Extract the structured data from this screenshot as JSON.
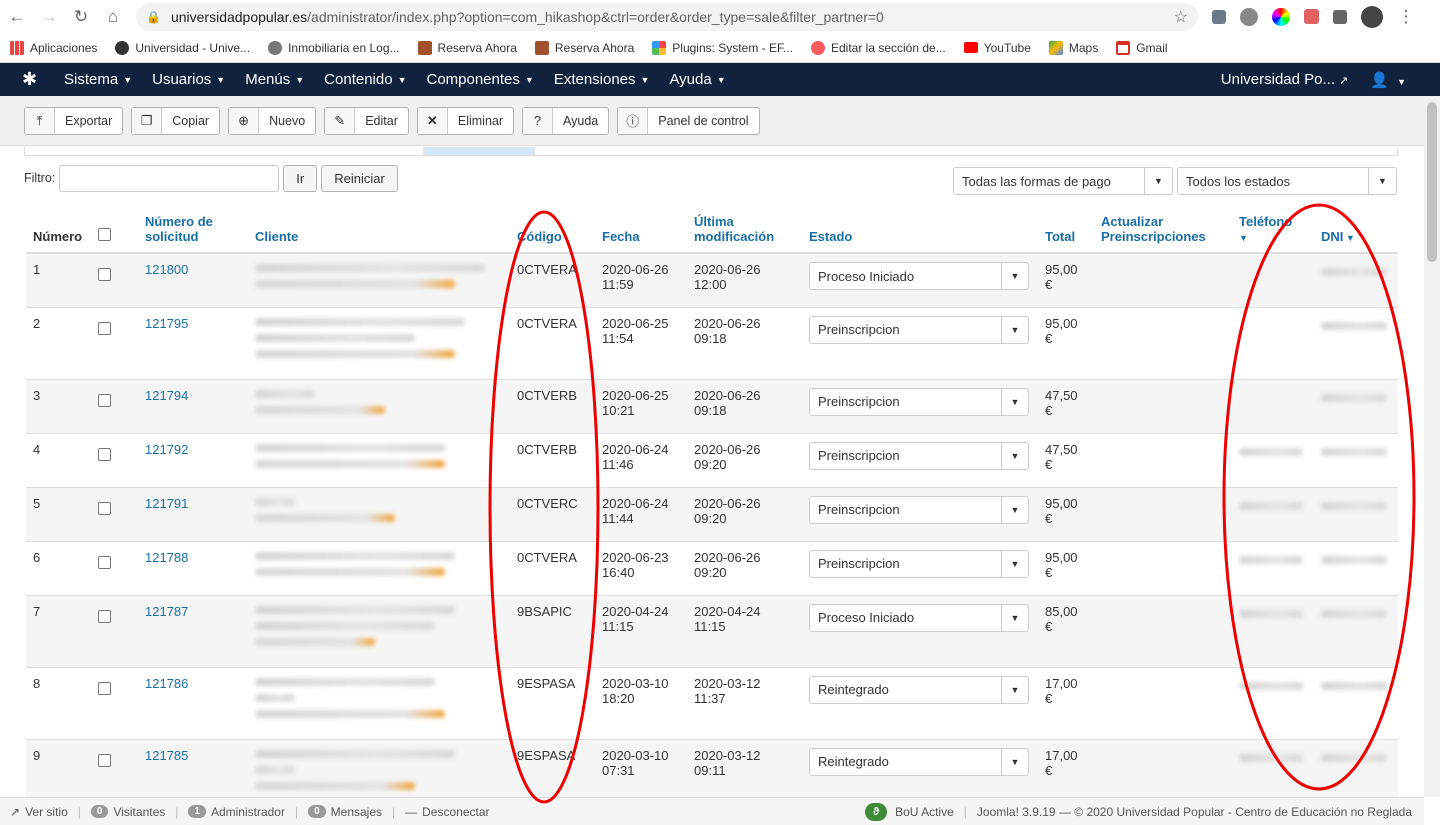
{
  "browser": {
    "url_host": "universidadpopular.es",
    "url_path": "/administrator/index.php?option=com_hikashop&ctrl=order&order_type=sale&filter_partner=0",
    "bookmarks": [
      "Aplicaciones",
      "Universidad - Unive...",
      "Inmobiliaria en Log...",
      "Reserva Ahora",
      "Reserva Ahora",
      "Plugins: System - EF...",
      "Editar la sección de...",
      "YouTube",
      "Maps",
      "Gmail"
    ]
  },
  "header": {
    "menu": [
      "Sistema",
      "Usuarios",
      "Menús",
      "Contenido",
      "Componentes",
      "Extensiones",
      "Ayuda"
    ],
    "site_name": "Universidad Po..."
  },
  "toolbar": {
    "buttons": [
      "Exportar",
      "Copiar",
      "Nuevo",
      "Editar",
      "Eliminar",
      "Ayuda",
      "Panel de control"
    ]
  },
  "filter": {
    "label": "Filtro:",
    "go": "Ir",
    "reset": "Reiniciar",
    "payment": "Todas las formas de pago",
    "status": "Todos los estados"
  },
  "table": {
    "headers": {
      "numero": "Número",
      "solicitud": "Número de solicitud",
      "cliente": "Cliente",
      "codigo": "Código",
      "fecha": "Fecha",
      "modificacion": "Última modificación",
      "estado": "Estado",
      "total": "Total",
      "actualizar": "Actualizar Preinscripciones",
      "telefono": "Teléfono",
      "dni": "DNI"
    },
    "rows": [
      {
        "n": "1",
        "id": "121800",
        "code": "0CTVERA",
        "date": "2020-06-26",
        "time": "11:59",
        "mdate": "2020-06-26",
        "mtime": "12:00",
        "estado": "Proceso Iniciado",
        "total": "95,00",
        "cur": "€"
      },
      {
        "n": "2",
        "id": "121795",
        "code": "0CTVERA",
        "date": "2020-06-25",
        "time": "11:54",
        "mdate": "2020-06-26",
        "mtime": "09:18",
        "estado": "Preinscripcion",
        "total": "95,00",
        "cur": "€"
      },
      {
        "n": "3",
        "id": "121794",
        "code": "0CTVERB",
        "date": "2020-06-25",
        "time": "10:21",
        "mdate": "2020-06-26",
        "mtime": "09:18",
        "estado": "Preinscripcion",
        "total": "47,50",
        "cur": "€"
      },
      {
        "n": "4",
        "id": "121792",
        "code": "0CTVERB",
        "date": "2020-06-24",
        "time": "11:46",
        "mdate": "2020-06-26",
        "mtime": "09:20",
        "estado": "Preinscripcion",
        "total": "47,50",
        "cur": "€"
      },
      {
        "n": "5",
        "id": "121791",
        "code": "0CTVERC",
        "date": "2020-06-24",
        "time": "11:44",
        "mdate": "2020-06-26",
        "mtime": "09:20",
        "estado": "Preinscripcion",
        "total": "95,00",
        "cur": "€"
      },
      {
        "n": "6",
        "id": "121788",
        "code": "0CTVERA",
        "date": "2020-06-23",
        "time": "16:40",
        "mdate": "2020-06-26",
        "mtime": "09:20",
        "estado": "Preinscripcion",
        "total": "95,00",
        "cur": "€"
      },
      {
        "n": "7",
        "id": "121787",
        "code": "9BSAPIC",
        "date": "2020-04-24",
        "time": "11:15",
        "mdate": "2020-04-24",
        "mtime": "11:15",
        "estado": "Proceso Iniciado",
        "total": "85,00",
        "cur": "€"
      },
      {
        "n": "8",
        "id": "121786",
        "code": "9ESPASA",
        "date": "2020-03-10",
        "time": "18:20",
        "mdate": "2020-03-12",
        "mtime": "11:37",
        "estado": "Reintegrado",
        "total": "17,00",
        "cur": "€"
      },
      {
        "n": "9",
        "id": "121785",
        "code": "9ESPASA",
        "date": "2020-03-10",
        "time": "07:31",
        "mdate": "2020-03-12",
        "mtime": "09:11",
        "estado": "Reintegrado",
        "total": "17,00",
        "cur": "€"
      }
    ]
  },
  "status": {
    "view_site": "Ver sitio",
    "visitors_count": "0",
    "visitors": "Visitantes",
    "admin_count": "1",
    "admin": "Administrador",
    "messages_count": "0",
    "messages": "Mensajes",
    "logout": "Desconectar",
    "bou": "BoU Active",
    "footer": "Joomla! 3.9.19 — © 2020 Universidad Popular - Centro de Educación no Reglada"
  }
}
